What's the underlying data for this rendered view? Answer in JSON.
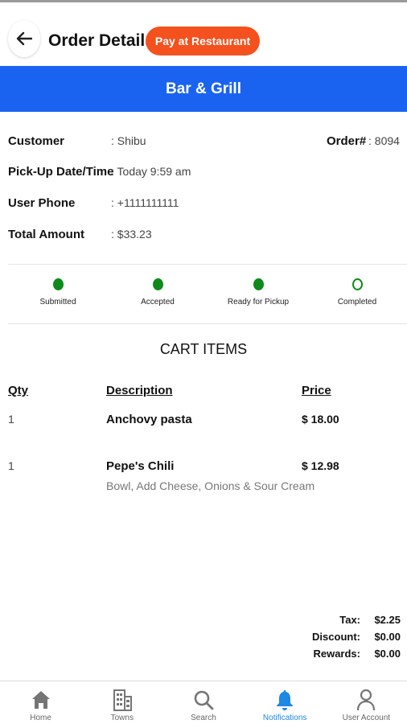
{
  "header": {
    "title": "Order Details",
    "pay_button": "Pay at Restaurant"
  },
  "banner": {
    "restaurant": "Bar & Grill"
  },
  "order_info": {
    "customer_label": "Customer",
    "customer_value": ": Shibu",
    "order_label": "Order#",
    "order_value": ": 8094",
    "pickup_label": "Pick-Up Date/Time",
    "pickup_value": ": Today 9:59 am",
    "phone_label": "User Phone",
    "phone_value": ": +1111111111",
    "total_label": "Total Amount",
    "total_value": ": $33.23"
  },
  "status_steps": [
    {
      "label": "Submitted",
      "done": true
    },
    {
      "label": "Accepted",
      "done": true
    },
    {
      "label": "Ready for Pickup",
      "done": true
    },
    {
      "label": "Completed",
      "done": false
    }
  ],
  "cart": {
    "title": "CART ITEMS",
    "headers": {
      "qty": "Qty",
      "description": "Description",
      "price": "Price"
    },
    "items": [
      {
        "qty": "1",
        "name": "Anchovy pasta",
        "details": "",
        "price": "$ 18.00"
      },
      {
        "qty": "1",
        "name": "Pepe's Chili",
        "details": "Bowl, Add Cheese, Onions & Sour Cream",
        "price": "$ 12.98"
      }
    ]
  },
  "totals": {
    "tax_label": "Tax:",
    "tax_value": "$2.25",
    "discount_label": "Discount:",
    "discount_value": "$0.00",
    "rewards_label": "Rewards:",
    "rewards_value": "$0.00"
  },
  "nav": {
    "items": [
      {
        "label": "Home",
        "icon": "home-icon"
      },
      {
        "label": "Towns",
        "icon": "buildings-icon"
      },
      {
        "label": "Search",
        "icon": "search-icon"
      },
      {
        "label": "Notifications",
        "icon": "bell-icon"
      },
      {
        "label": "User Account",
        "icon": "user-icon"
      }
    ],
    "active_index": 3
  },
  "colors": {
    "accent": "#1a63f0",
    "pay_button": "#f4511e",
    "status_green": "#0e8a1a",
    "nav_active": "#1e88e5"
  }
}
